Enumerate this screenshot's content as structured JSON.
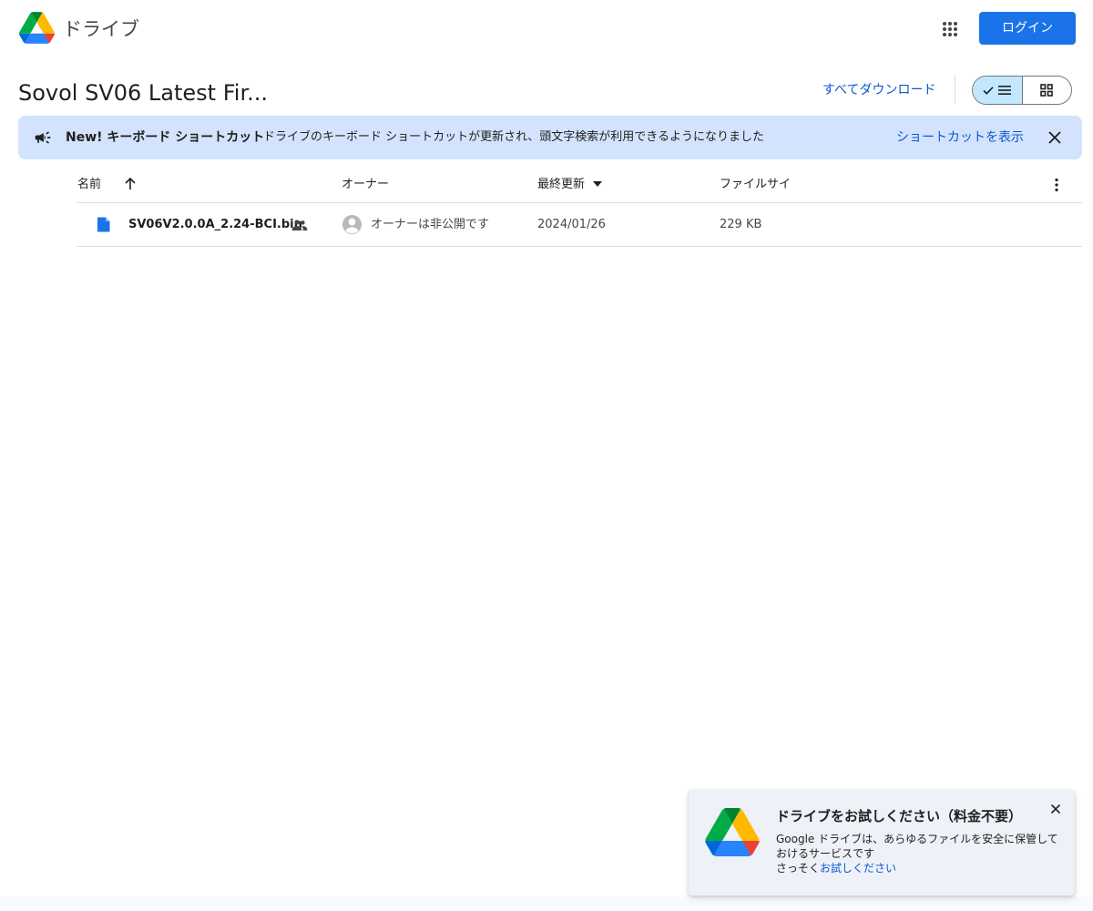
{
  "header": {
    "app_title": "ドライブ",
    "login_label": "ログイン"
  },
  "folder": {
    "title": "Sovol SV06 Latest Fir...",
    "download_all_label": "すべてダウンロード"
  },
  "banner": {
    "title": "New! キーボード ショートカット",
    "text": "ドライブのキーボード ショートカットが更新され、頭文字検索が利用できるようになりました",
    "link_label": "ショートカットを表示"
  },
  "table": {
    "columns": {
      "name": "名前",
      "owner": "オーナー",
      "modified": "最終更新",
      "size": "ファイルサイ"
    },
    "rows": [
      {
        "name": "SV06V2.0.0A_2.24-BCI.bin",
        "owner": "オーナーは非公開です",
        "modified": "2024/01/26",
        "size": "229 KB"
      }
    ]
  },
  "promo": {
    "title": "ドライブをお試しください（料金不要）",
    "body": "Google ドライブは、あらゆるファイルを安全に保管しておけるサービスです",
    "try_prefix": "さっそく",
    "try_link": "お試しください"
  },
  "colors": {
    "accent": "#1a73e8",
    "link": "#0b57d0",
    "banner_bg": "#d3e3fd",
    "selected_toggle": "#c2e7ff",
    "file_icon": "#1a73e8"
  },
  "icons": {
    "logo": "google-drive-logo",
    "apps": "apps-grid-icon",
    "view_list": "list-view-icon",
    "view_grid": "grid-view-icon",
    "banner": "megaphone-icon",
    "close": "close-icon",
    "sort": "arrow-up-icon",
    "more": "more-vert-icon",
    "file": "file-icon",
    "shared": "people-icon",
    "avatar": "account-circle-icon"
  }
}
